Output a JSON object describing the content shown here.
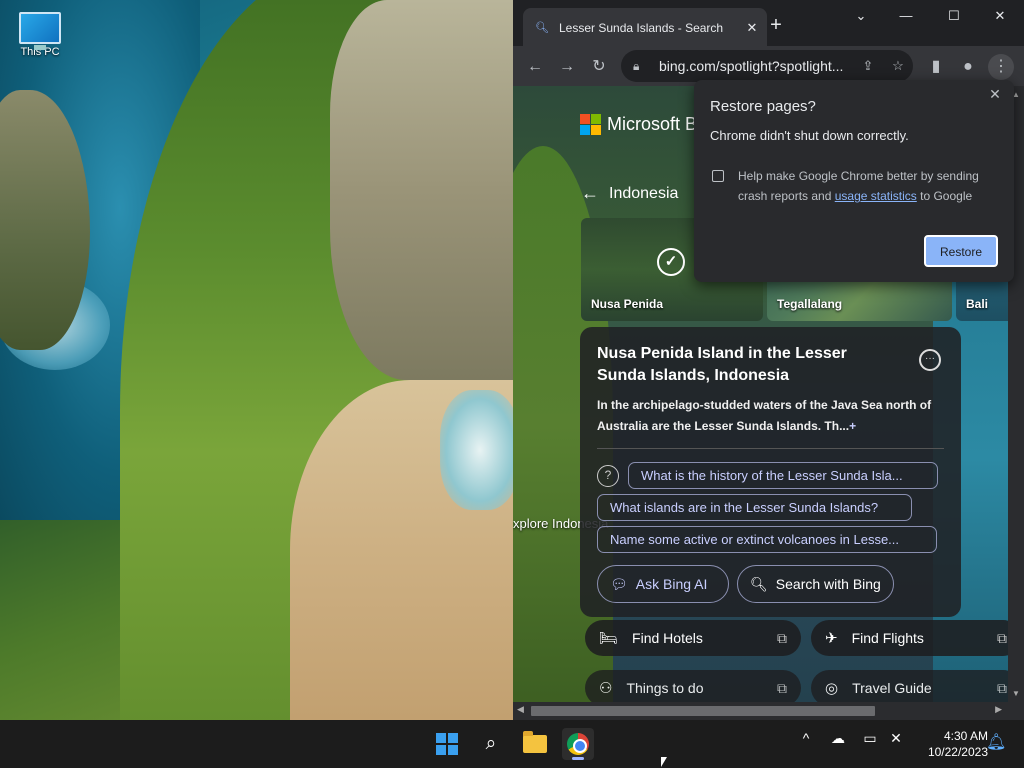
{
  "desktop": {
    "icons": [
      {
        "label": "This PC",
        "icon": "this-pc-icon"
      }
    ]
  },
  "browser": {
    "tab": {
      "title": "Lesser Sunda Islands - Search",
      "favicon": "search-icon"
    },
    "new_tab": "+",
    "window_controls": {
      "tab_search": "⌄",
      "minimize": "—",
      "maximize": "☐",
      "close": "✕"
    },
    "toolbar": {
      "back": "←",
      "forward": "→",
      "reload": "↻",
      "url": "bing.com/spotlight?spotlight...",
      "share": "⇪",
      "bookmark": "☆",
      "side_panel": "▮",
      "profile": "●",
      "menu": "⋮"
    }
  },
  "bing": {
    "logo_text": "Microsoft Bi",
    "back_label": "Indonesia",
    "carousel": [
      {
        "label": "Nusa Penida",
        "selected": true
      },
      {
        "label": "Tegallalang",
        "selected": false
      },
      {
        "label": "Bali",
        "selected": false
      }
    ],
    "side_text": "xplore Indonesia",
    "card": {
      "title": "Nusa Penida Island in the Lesser Sunda Islands, Indonesia",
      "description": "In the archipelago-studded waters of the Java Sea north of Australia are the Lesser Sunda Islands. Th...",
      "expand": "+",
      "suggestions": [
        "What is the history of the Lesser Sunda Isla...",
        "What islands are in the Lesser Sunda Islands?",
        "Name some active or extinct volcanoes in Lesse..."
      ],
      "ask_label": "Ask Bing AI",
      "search_label": "Search with Bing"
    },
    "quick_links": [
      {
        "label": "Find Hotels",
        "icon": "bed-icon"
      },
      {
        "label": "Find Flights",
        "icon": "plane-icon"
      },
      {
        "label": "Things to do",
        "icon": "binoculars-icon"
      },
      {
        "label": "Travel Guide",
        "icon": "compass-icon"
      }
    ]
  },
  "restore_popup": {
    "title": "Restore pages?",
    "message": "Chrome didn't shut down correctly.",
    "help_text_1": "Help make Google Chrome better by sending crash reports and",
    "help_link": "usage statistics",
    "help_text_2": "to Google",
    "restore_label": "Restore",
    "close": "✕"
  },
  "taskbar": {
    "time": "4:30 AM",
    "date": "10/22/2023",
    "tray_chevron": "^",
    "colors": {
      "accent": "#3aa0f0",
      "link": "#8ab4f8"
    }
  }
}
